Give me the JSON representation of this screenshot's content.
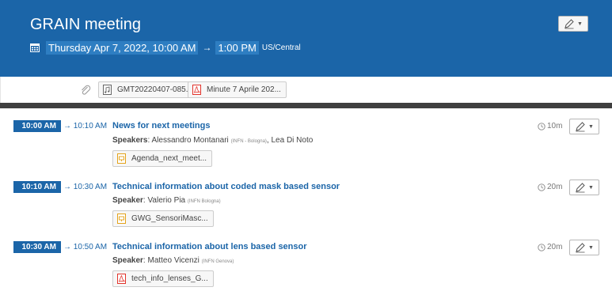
{
  "event": {
    "title": "GRAIN meeting",
    "date": "Thursday Apr 7, 2022, 10:00 AM",
    "arrow": "→",
    "end_time": "1:00 PM",
    "timezone": "US/Central"
  },
  "attachments": [
    {
      "name": "GMT20220407-085...",
      "icon": "audio-file-icon"
    },
    {
      "name": "Minute 7 Aprile 202...",
      "icon": "pdf-file-icon"
    }
  ],
  "contributions": [
    {
      "start": "10:00 AM",
      "end": "→ 10:10 AM",
      "title": "News for next meetings",
      "speaker_label": "Speakers",
      "speakers": [
        {
          "name": "Alessandro Montanari",
          "affiliation": "(INFN - Bologna)",
          "sep": ", "
        },
        {
          "name": "Lea Di Noto",
          "affiliation": "",
          "sep": ""
        }
      ],
      "file": {
        "name": "Agenda_next_meet...",
        "icon": "presentation-file-icon"
      },
      "duration": "10m"
    },
    {
      "start": "10:10 AM",
      "end": "→ 10:30 AM",
      "title": "Technical information about coded mask based sensor",
      "speaker_label": "Speaker",
      "speakers": [
        {
          "name": "Valerio Pia",
          "affiliation": "(INFN Bologna)",
          "sep": ""
        }
      ],
      "file": {
        "name": "GWG_SensoriMasc...",
        "icon": "presentation-file-icon"
      },
      "duration": "20m"
    },
    {
      "start": "10:30 AM",
      "end": "→ 10:50 AM",
      "title": "Technical information about lens based sensor",
      "speaker_label": "Speaker",
      "speakers": [
        {
          "name": "Matteo Vicenzi",
          "affiliation": "(INFN Genova)",
          "sep": ""
        }
      ],
      "file": {
        "name": "tech_info_lenses_G...",
        "icon": "pdf-file-icon"
      },
      "duration": "20m"
    }
  ],
  "colors": {
    "header": "#1b65a8",
    "band": "#3f3f3f",
    "pdf": "#e2332b",
    "ppt": "#e3a21a"
  }
}
